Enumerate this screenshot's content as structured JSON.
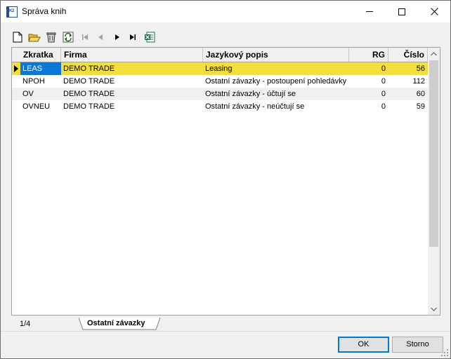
{
  "window": {
    "title": "Správa knih",
    "app_icon_text": "K2",
    "icons": {
      "minimize": "minimize-icon",
      "maximize": "maximize-icon",
      "close": "close-icon"
    }
  },
  "toolbar": {
    "buttons": [
      "new-icon",
      "open-folder-icon",
      "delete-icon",
      "refresh-icon",
      "first-record-icon",
      "previous-record-icon",
      "next-record-icon",
      "last-record-icon",
      "excel-export-icon"
    ]
  },
  "grid": {
    "columns": {
      "zkratka": "Zkratka",
      "firma": "Firma",
      "popis": "Jazykový popis",
      "rg": "RG",
      "cislo": "Číslo"
    },
    "rows": [
      {
        "zkratka": "LEAS",
        "firma": "DEMO TRADE",
        "popis": "Leasing",
        "rg": "0",
        "cislo": "56"
      },
      {
        "zkratka": "NPOH",
        "firma": "DEMO TRADE",
        "popis": "Ostatní závazky - postoupení pohledávky",
        "rg": "0",
        "cislo": "112"
      },
      {
        "zkratka": "OV",
        "firma": "DEMO TRADE",
        "popis": "Ostatní závazky - účtují se",
        "rg": "0",
        "cislo": "60"
      },
      {
        "zkratka": "OVNEU",
        "firma": "DEMO TRADE",
        "popis": "Ostatní závazky - neúčtují se",
        "rg": "0",
        "cislo": "59"
      }
    ],
    "selected_row_color": "#f2df3c",
    "active_cell_color": "#0a78d7"
  },
  "status": {
    "record_position": "1/4",
    "tab_label": "Ostatní závazky"
  },
  "buttons": {
    "ok": "OK",
    "cancel": "Storno"
  }
}
